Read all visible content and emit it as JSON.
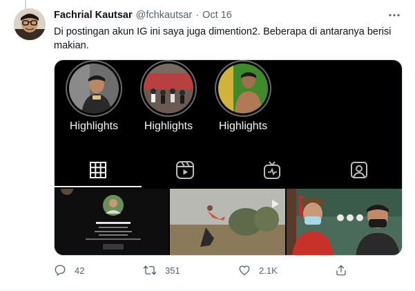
{
  "tweet": {
    "author_name": "Fachrial Kautsar",
    "author_handle": "@fchkautsar",
    "separator": "·",
    "timestamp": "Oct 16",
    "text": "Di postingan akun IG ini saya juga dimention2. Beberapa di antaranya berisi makian."
  },
  "media": {
    "highlights": [
      {
        "label": "Highlights"
      },
      {
        "label": "Highlights"
      },
      {
        "label": "Highlights"
      }
    ],
    "tabs": [
      {
        "icon": "grid-icon",
        "selected": true
      },
      {
        "icon": "reels-icon",
        "selected": false
      },
      {
        "icon": "igtv-icon",
        "selected": false
      },
      {
        "icon": "tagged-icon",
        "selected": false
      }
    ],
    "thumbnails": [
      {
        "profile_name": "Jenda Munthe"
      }
    ]
  },
  "actions": {
    "reply_count": "42",
    "retweet_count": "351",
    "like_count": "2.1K"
  },
  "colors": {
    "text_primary": "#0f1419",
    "text_secondary": "#536471",
    "media_background": "#000000"
  }
}
